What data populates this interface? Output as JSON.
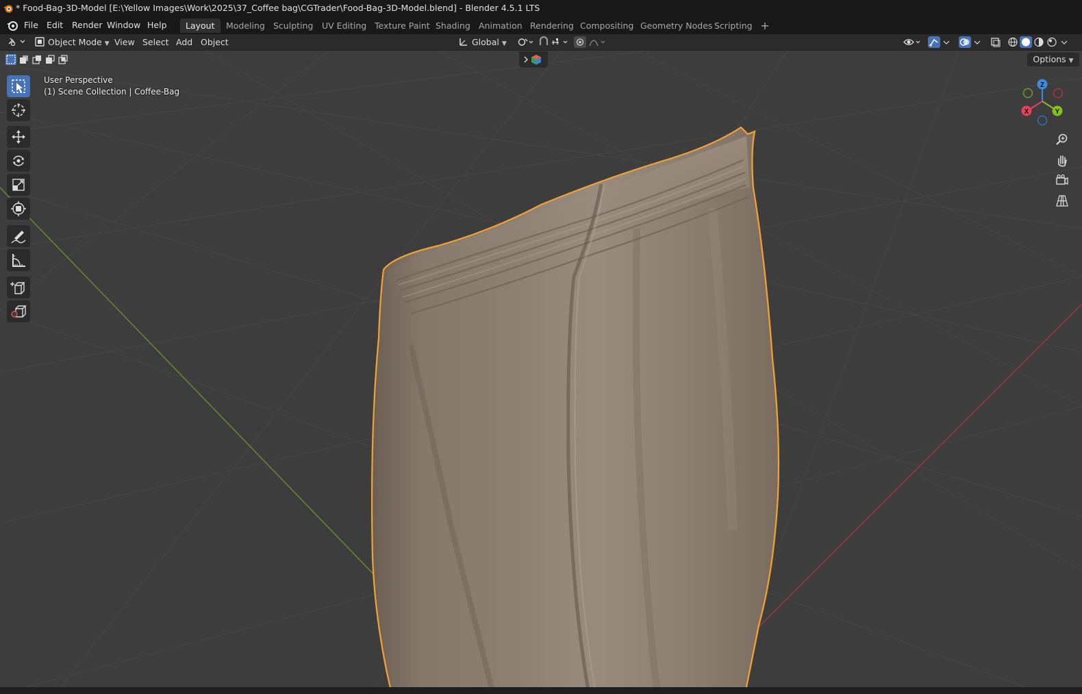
{
  "titlebar": {
    "title": "* Food-Bag-3D-Model [E:\\Yellow Images\\Work\\2025\\37_Coffee bag\\CGTrader\\Food-Bag-3D-Model.blend] - Blender 4.5.1 LTS",
    "icon": "blender-icon"
  },
  "menus": [
    "File",
    "Edit",
    "Render",
    "Window",
    "Help"
  ],
  "workspaces": [
    "Layout",
    "Modeling",
    "Sculpting",
    "UV Editing",
    "Texture Paint",
    "Shading",
    "Animation",
    "Rendering",
    "Compositing",
    "Geometry Nodes",
    "Scripting"
  ],
  "active_workspace": "Layout",
  "header": {
    "mode": "Object Mode",
    "menus": [
      "View",
      "Select",
      "Add",
      "Object"
    ],
    "orientation": "Global",
    "options_label": "Options"
  },
  "viewport": {
    "view_name": "User Perspective",
    "collection_info": "(1) Scene Collection | Coffee-Bag",
    "selected_object": "Coffee-Bag",
    "outline_color": "#f5a234",
    "object_color": "#9a8a7b"
  },
  "gizmo": {
    "axes": [
      "X",
      "Y",
      "Z"
    ],
    "colors": {
      "x": "#e8405a",
      "y": "#83c21a",
      "z": "#3b8ce0"
    }
  },
  "tools": [
    "select-box",
    "cursor",
    "move",
    "rotate",
    "scale",
    "transform",
    "annotate",
    "measure",
    "add-cube",
    "add-primitive"
  ],
  "colors": {
    "accent": "#4772b3",
    "background": "#3d3d3d",
    "grid_line": "#474747",
    "x_axis": "#9a3a48",
    "y_axis": "#6f8b2e"
  }
}
